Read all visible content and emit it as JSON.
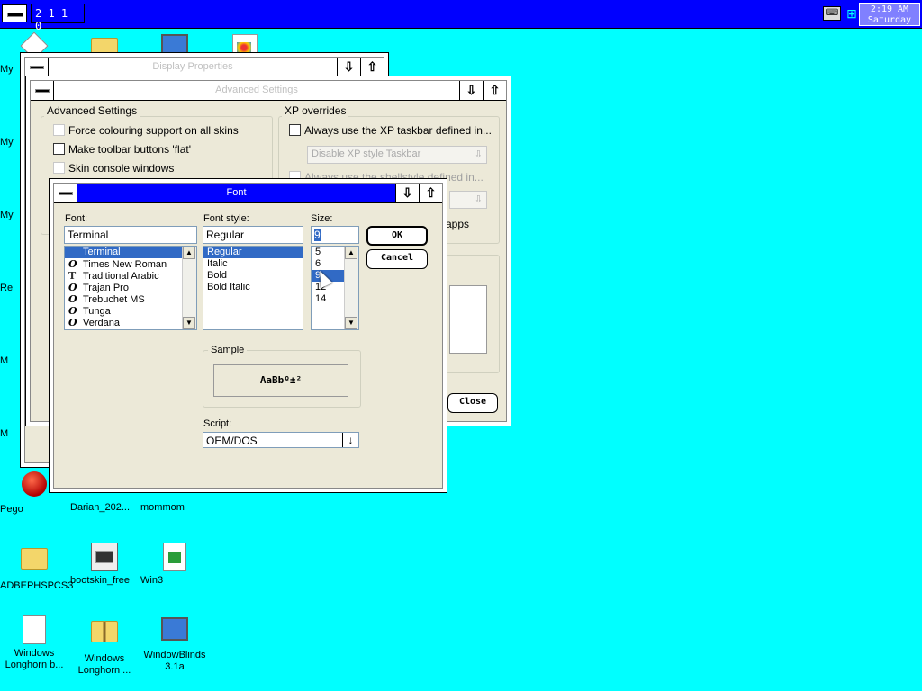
{
  "taskbar": {
    "task_label": "2 1 1 0",
    "clock_time": "2:19 AM",
    "clock_day": "Saturday"
  },
  "desktop": {
    "partial_labels": [
      "My",
      "My",
      "My",
      "Re",
      "M",
      "M"
    ],
    "icons": [
      {
        "label": "Pego"
      },
      {
        "label": "Darian_202..."
      },
      {
        "label": "mommom"
      },
      {
        "label": "ADBEPHSPCS3"
      },
      {
        "label": "bootskin_free"
      },
      {
        "label": "Win3"
      },
      {
        "label": "Windows Longhorn b..."
      },
      {
        "label": "Windows Longhorn ..."
      },
      {
        "label": "WindowBlinds 3.1a"
      }
    ]
  },
  "window_back": {
    "title": "Display Properties",
    "min_glyph": "⇩",
    "max_glyph": "⇧"
  },
  "window_advanced": {
    "title": "Advanced Settings",
    "min_glyph": "⇩",
    "max_glyph": "⇧",
    "group_advanced": {
      "title": "Advanced Settings",
      "force_colour": "Force colouring support on all skins",
      "flat_buttons": "Make toolbar buttons 'flat'",
      "skin_console": "Skin console windows"
    },
    "group_xp": {
      "title": "XP overrides",
      "xp_taskbar": "Always use the XP taskbar defined in...",
      "disable_xp": "Disable XP style Taskbar",
      "shellstyle": "Always use the shellstyle defined in...",
      "apps": "apps"
    },
    "close_button": "Close"
  },
  "font_dialog": {
    "title": "Font",
    "min_glyph": "⇩",
    "max_glyph": "⇧",
    "font_label": "Font:",
    "font_value": "Terminal",
    "fonts": [
      {
        "glyph": "",
        "name": "Terminal",
        "selected": true
      },
      {
        "glyph": "O",
        "name": "Times New Roman"
      },
      {
        "glyph": "T",
        "name": "Traditional Arabic"
      },
      {
        "glyph": "O",
        "name": "Trajan Pro"
      },
      {
        "glyph": "O",
        "name": "Trebuchet MS"
      },
      {
        "glyph": "O",
        "name": "Tunga"
      },
      {
        "glyph": "O",
        "name": "Verdana"
      }
    ],
    "style_label": "Font style:",
    "style_value": "Regular",
    "styles": [
      "Regular",
      "Italic",
      "Bold",
      "Bold Italic"
    ],
    "size_label": "Size:",
    "size_value": "9",
    "sizes": [
      "5",
      "6",
      "9",
      "12",
      "14"
    ],
    "ok_button": "OK",
    "cancel_button": "Cancel",
    "sample_label": "Sample",
    "sample_text": "AaBbº±²",
    "script_label": "Script:",
    "script_value": "OEM/DOS"
  }
}
